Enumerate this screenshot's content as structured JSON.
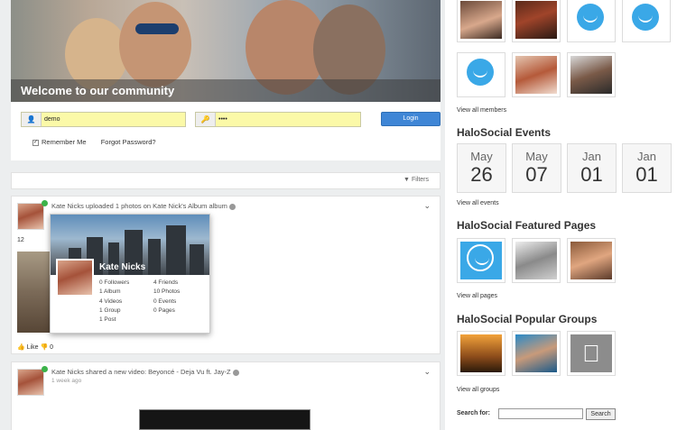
{
  "hero": {
    "caption": "Welcome to our community"
  },
  "login": {
    "username_value": "demo",
    "password_value": "••••",
    "login_label": "Login",
    "remember_label": "Remember Me",
    "forgot_label": "Forgot Password?"
  },
  "filter": {
    "label": "Filters"
  },
  "post1": {
    "headline": "Kate Nicks uploaded 1 photos on Kate Nick's Album album",
    "number": "12",
    "like_label": "Like",
    "dislike_count": "0"
  },
  "hovercard": {
    "name": "Kate Nicks",
    "stats_left": [
      "0 Followers",
      "1 Album",
      "4 Videos",
      "1 Group",
      "1 Post"
    ],
    "stats_right": [
      "4 Friends",
      "10 Photos",
      "0 Events",
      "0 Pages"
    ]
  },
  "post2": {
    "headline": "Kate Nicks shared a new video: Beyoncé - Deja Vu ft. Jay-Z",
    "time": "1 week ago"
  },
  "sidebar": {
    "view_all_members": "View all members",
    "events_title": "HaloSocial Events",
    "events": [
      {
        "month": "May",
        "day": "26"
      },
      {
        "month": "May",
        "day": "07"
      },
      {
        "month": "Jan",
        "day": "01"
      },
      {
        "month": "Jan",
        "day": "01"
      }
    ],
    "view_all_events": "View all events",
    "pages_title": "HaloSocial Featured Pages",
    "view_all_pages": "View all pages",
    "groups_title": "HaloSocial Popular Groups",
    "view_all_groups": "View all groups",
    "search_label": "Search for:",
    "search_button": "Search"
  },
  "colors": {
    "accent": "#3f86d6",
    "smiley": "#3aa8e7",
    "online": "#3cb34a",
    "input_bg": "#fbf9a8"
  }
}
